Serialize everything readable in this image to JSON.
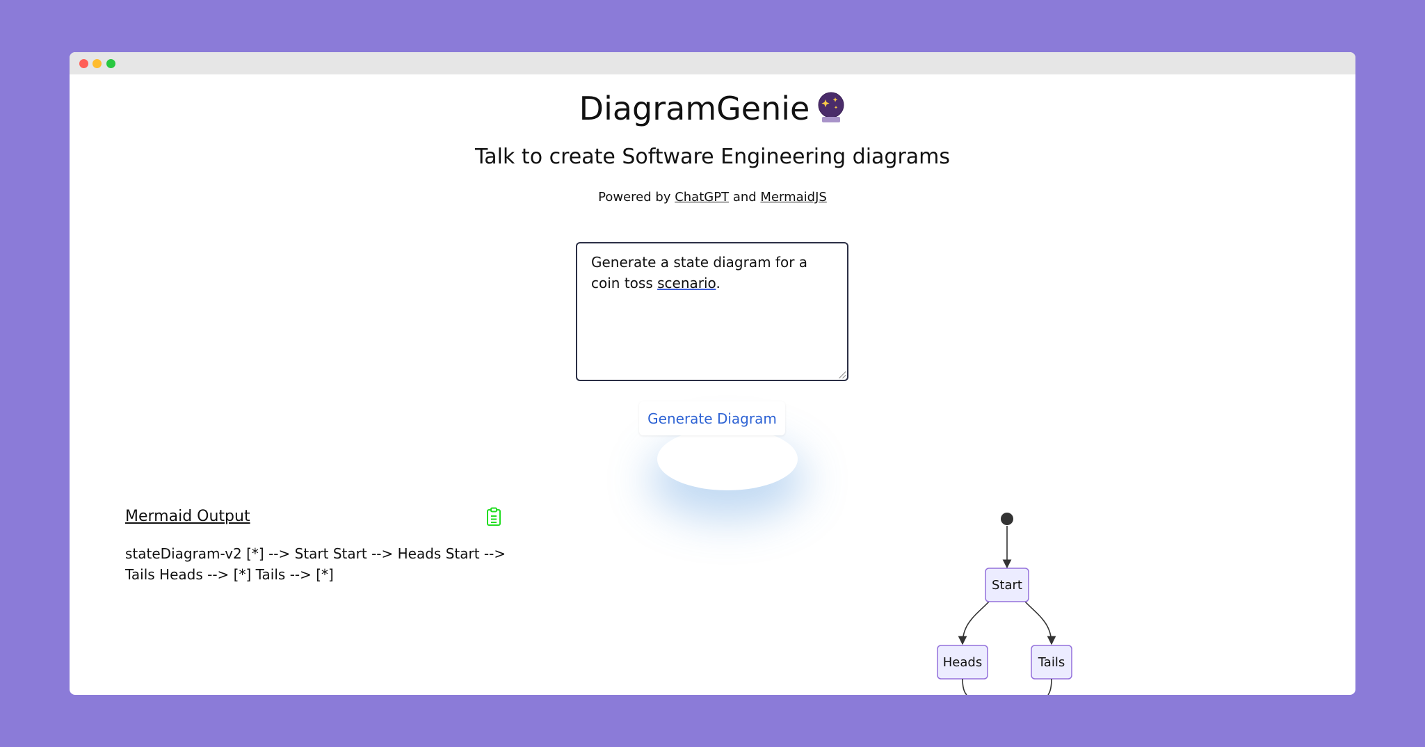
{
  "app": {
    "title": "DiagramGenie",
    "title_icon": "crystal-ball-icon",
    "subtitle": "Talk to create Software Engineering diagrams",
    "powered_prefix": "Powered by",
    "powered_link1": "ChatGPT",
    "powered_and": "and",
    "powered_link2": "MermaidJS"
  },
  "prompt": {
    "value_before": "Generate a state diagram for a coin toss",
    "value_spell": "scenario",
    "value_after": "."
  },
  "toolbar": {
    "generate_label": "Generate Diagram"
  },
  "output": {
    "label": "Mermaid Output",
    "copy_icon": "clipboard-icon",
    "code": "stateDiagram-v2 [*] --> Start Start --> Heads Start --> Tails Heads --> [*] Tails --> [*]"
  },
  "diagram": {
    "type": "stateDiagram-v2",
    "states": [
      "Start",
      "Heads",
      "Tails"
    ],
    "transitions": [
      {
        "from": "[*]",
        "to": "Start"
      },
      {
        "from": "Start",
        "to": "Heads"
      },
      {
        "from": "Start",
        "to": "Tails"
      },
      {
        "from": "Heads",
        "to": "[*]"
      },
      {
        "from": "Tails",
        "to": "[*]"
      }
    ]
  },
  "colors": {
    "background": "#8b7bd8",
    "button_text": "#2e63d4",
    "copy_icon": "#22dd22",
    "node_fill": "#ececff",
    "node_stroke": "#9370db"
  }
}
